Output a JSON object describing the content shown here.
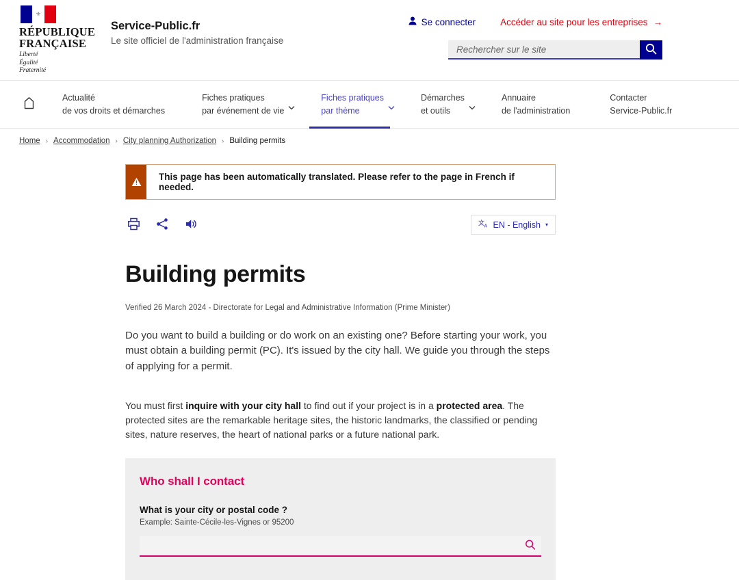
{
  "header": {
    "republic_line1": "RÉPUBLIQUE",
    "republic_line2": "FRANÇAISE",
    "motto_1": "Liberté",
    "motto_2": "Égalité",
    "motto_3": "Fraternité",
    "site_name": "Service-Public.fr",
    "site_tagline": "Le site officiel de l'administration française",
    "login_label": "Se connecter",
    "business_label": "Accéder au site pour les entreprises",
    "business_arrow": "→",
    "search_placeholder": "Rechercher sur le site",
    "search_value": "",
    "search_icon": "search-icon",
    "user_icon": "user-icon"
  },
  "nav": {
    "home_icon": "home-icon",
    "items": [
      {
        "line1": "Actualité",
        "line2": "de vos droits et démarches",
        "has_caret": false,
        "active": false
      },
      {
        "line1": "Fiches pratiques",
        "line2": "par événement de vie",
        "has_caret": true,
        "active": false
      },
      {
        "line1": "Fiches pratiques",
        "line2": "par thème",
        "has_caret": true,
        "active": true
      },
      {
        "line1": "Démarches",
        "line2": "et outils",
        "has_caret": true,
        "active": false
      },
      {
        "line1": "Annuaire",
        "line2": "de l'administration",
        "has_caret": false,
        "active": false
      },
      {
        "line1": "Contacter",
        "line2": "Service-Public.fr",
        "has_caret": false,
        "active": false
      }
    ]
  },
  "breadcrumb": {
    "items": [
      "Home",
      "Accommodation",
      "City planning Authorization"
    ],
    "current": "Building permits",
    "separator": "›"
  },
  "alert": {
    "icon": "warning-triangle-icon",
    "text": "This page has been automatically translated. Please refer to the page in French if needed.",
    "bar_color": "#b14200",
    "border_color": "#d8a278"
  },
  "toolbar": {
    "print_icon": "print-icon",
    "share_icon": "share-icon",
    "listen_icon": "speaker-icon",
    "translate_icon": "translate-icon",
    "language_label": "EN - English",
    "caret": "▾"
  },
  "main": {
    "title": "Building permits",
    "meta": "Verified 26 March 2024 - Directorate for Legal and Administrative Information (Prime Minister)",
    "lead_paragraph": "Do you want to build a building or do work on an existing one? Before starting your work, you must obtain a building permit (PC). It's issued by the city hall. We guide you through the steps of applying for a permit.",
    "second_paragraph": {
      "part1": "You must first ",
      "bold1": "inquire with your city hall",
      "part2": " to find out if your project is in a ",
      "bold2": "protected area",
      "part3": ". The protected sites are the remarkable heritage sites, the historic landmarks, the classified or pending sites, nature reserves, the heart of national parks or a future national park."
    }
  },
  "contact_box": {
    "title": "Who shall I contact",
    "question": "What is your city or postal code ?",
    "example": "Example: Sainte-Cécile-les-Vignes or 95200",
    "input_value": "",
    "input_placeholder": "",
    "search_icon": "search-icon",
    "accent_color": "#d4006a",
    "background": "#eeeeee"
  },
  "colors": {
    "brand_blue": "#000091",
    "nav_active": "#4a45c4",
    "red": "#e1000f",
    "pink": "#e1005a",
    "alert_orange": "#b14200"
  }
}
